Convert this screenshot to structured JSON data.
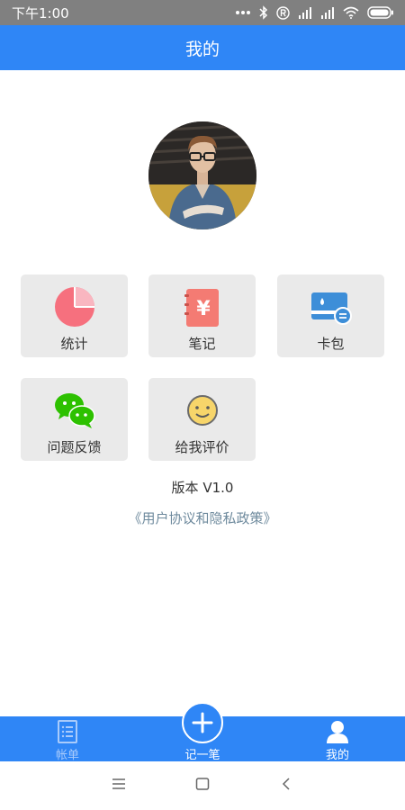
{
  "status_bar": {
    "time": "下午1:00"
  },
  "header": {
    "title": "我的"
  },
  "tiles": {
    "stats": {
      "label": "统计"
    },
    "notes": {
      "label": "笔记",
      "icon_glyph": "¥"
    },
    "cards": {
      "label": "卡包"
    },
    "feedback": {
      "label": "问题反馈"
    },
    "rate": {
      "label": "给我评价"
    }
  },
  "version": {
    "text": "版本 V1.0"
  },
  "agreement": {
    "text": "《用户协议和隐私政策》"
  },
  "tab_bar": {
    "bills": {
      "label": "帐单",
      "icon": "list-icon"
    },
    "add": {
      "label": "记一笔",
      "icon": "plus-icon"
    },
    "mine": {
      "label": "我的",
      "icon": "person-icon"
    }
  },
  "colors": {
    "primary": "#2f86f6",
    "tile_background": "#eaeaea",
    "pie": "#f6707e",
    "notebook": "#f47b73",
    "wallet": "#3d8ed8",
    "wechat": "#2dc100",
    "smiley": "#f7d56a",
    "link": "#6e8a9d"
  }
}
